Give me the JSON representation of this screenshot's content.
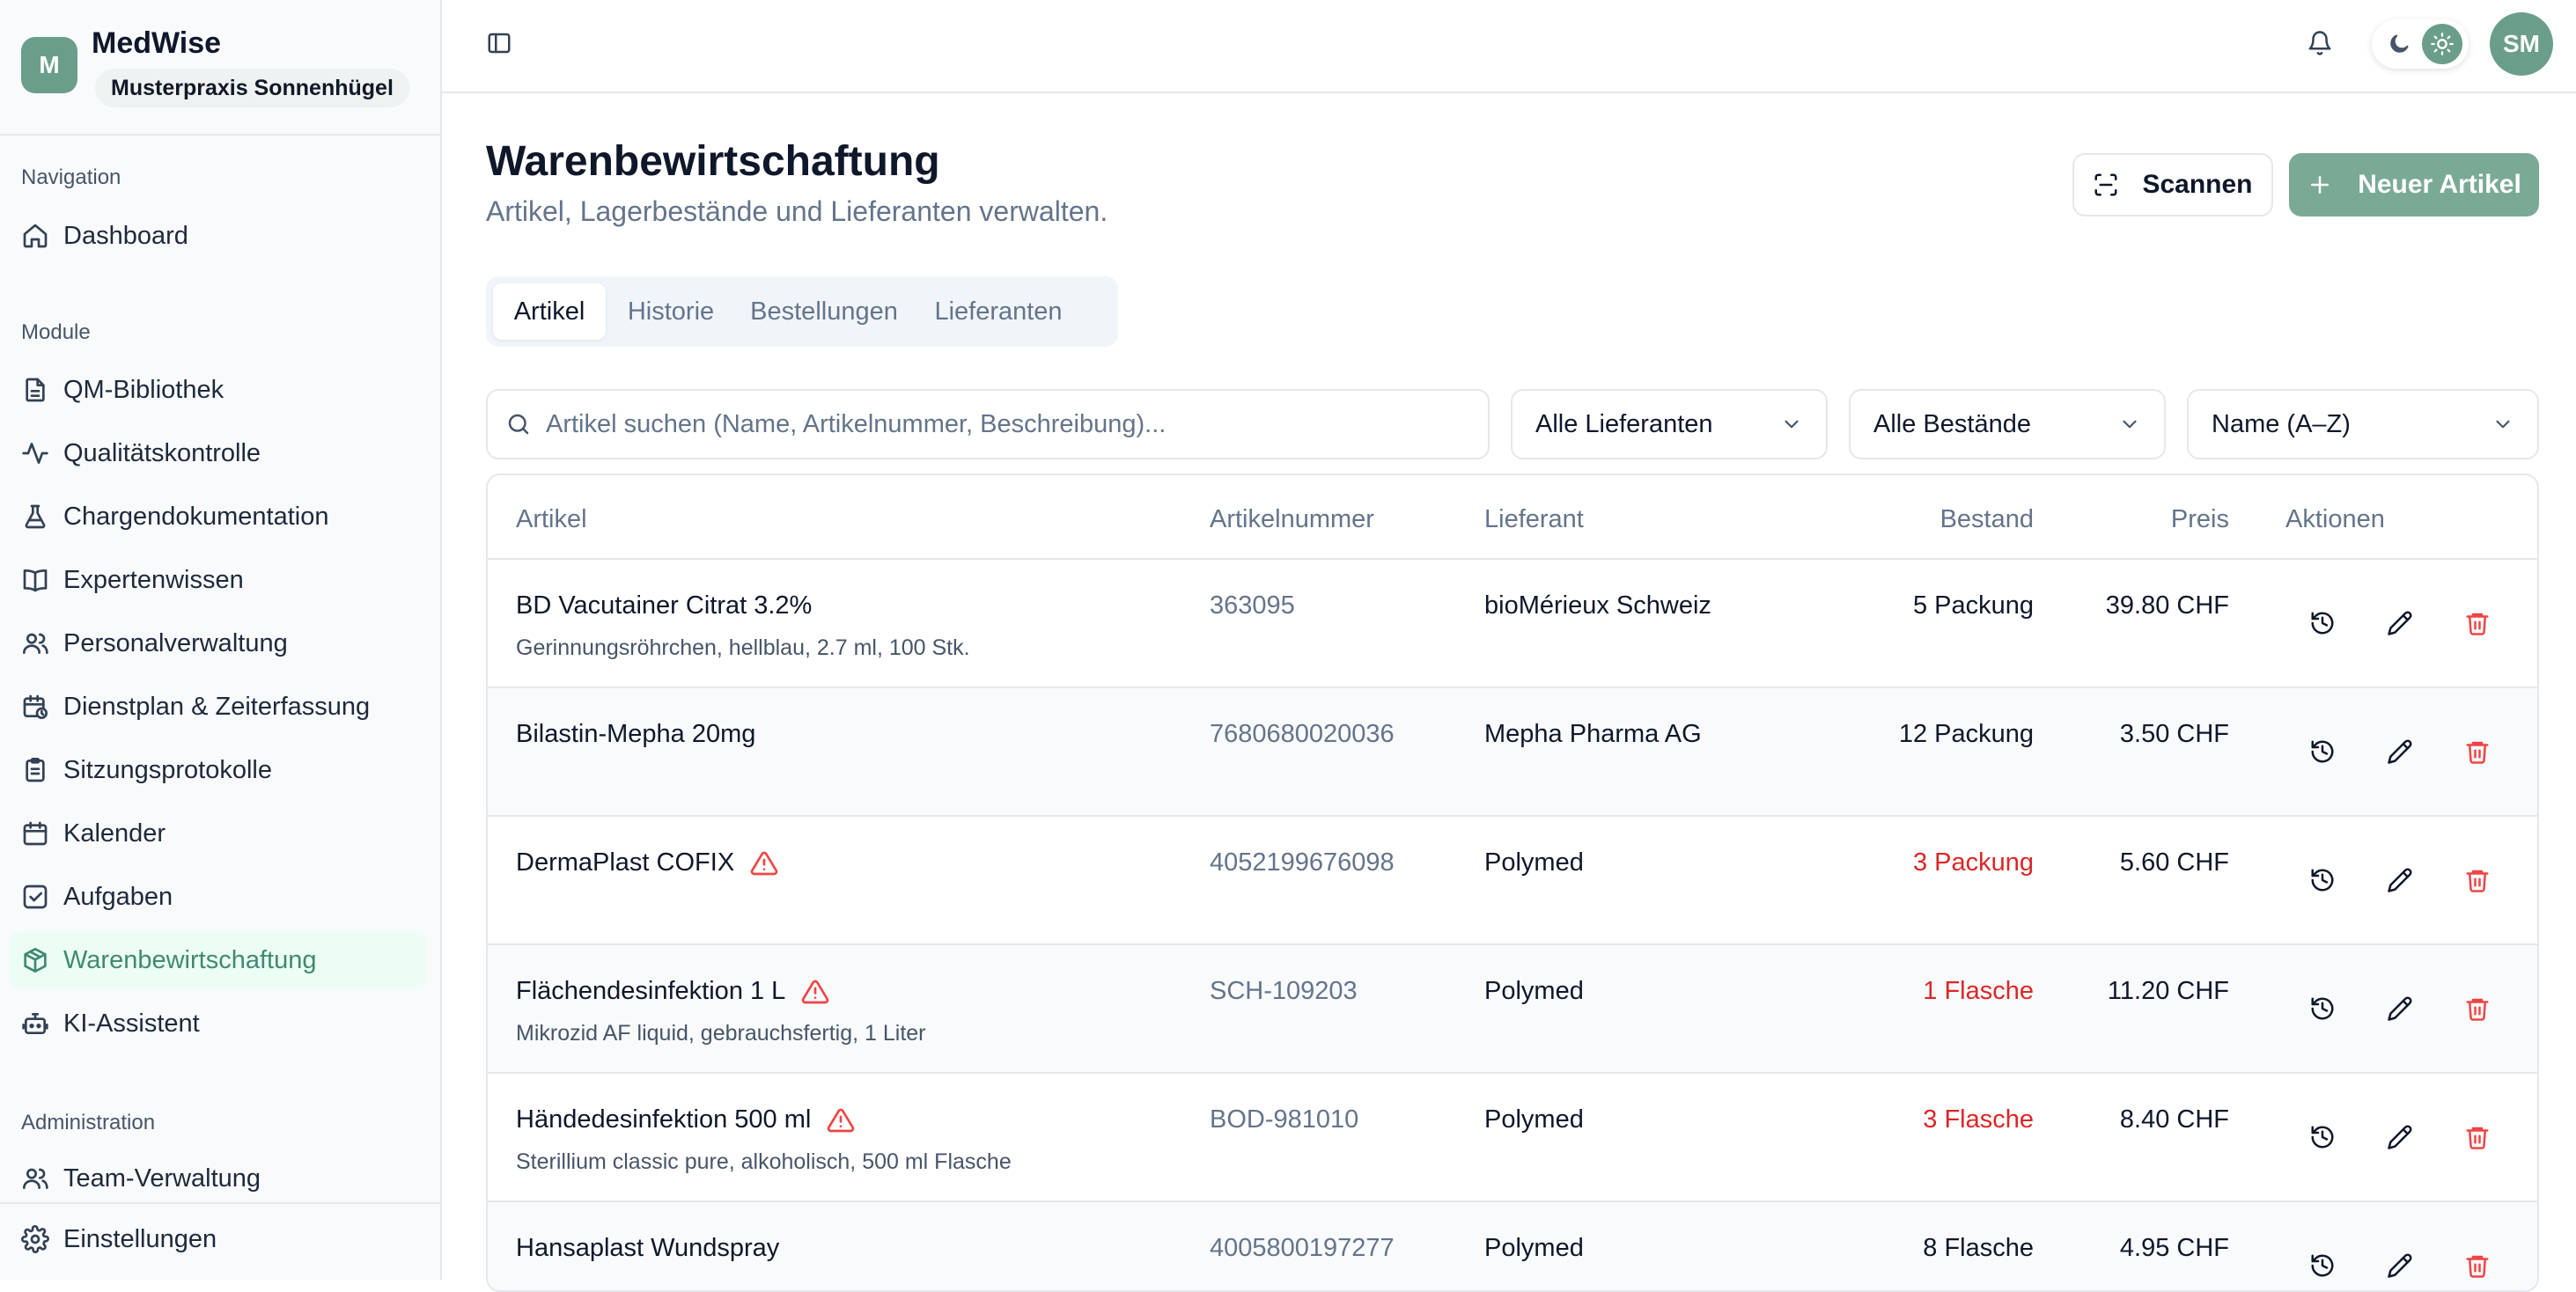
{
  "app": {
    "name": "MedWise",
    "logo_letter": "M",
    "practice": "Musterpraxis Sonnenhügel"
  },
  "sidebar": {
    "sections": {
      "navigation": "Navigation",
      "module": "Module",
      "administration": "Administration"
    },
    "items": [
      {
        "label": "Dashboard",
        "icon": "home-icon"
      },
      {
        "label": "QM-Bibliothek",
        "icon": "document-icon"
      },
      {
        "label": "Qualitätskontrolle",
        "icon": "activity-icon"
      },
      {
        "label": "Chargendokumentation",
        "icon": "flask-icon"
      },
      {
        "label": "Expertenwissen",
        "icon": "book-icon"
      },
      {
        "label": "Personalverwaltung",
        "icon": "users-icon"
      },
      {
        "label": "Dienstplan & Zeiterfassung",
        "icon": "calendar-clock-icon"
      },
      {
        "label": "Sitzungsprotokolle",
        "icon": "clipboard-icon"
      },
      {
        "label": "Kalender",
        "icon": "calendar-icon"
      },
      {
        "label": "Aufgaben",
        "icon": "checkbox-icon"
      },
      {
        "label": "Warenbewirtschaftung",
        "icon": "package-icon",
        "active": true
      },
      {
        "label": "KI-Assistent",
        "icon": "bot-icon"
      },
      {
        "label": "Team-Verwaltung",
        "icon": "users-icon"
      }
    ],
    "settings": "Einstellungen"
  },
  "topbar": {
    "avatar_initials": "SM"
  },
  "header": {
    "title": "Warenbewirtschaftung",
    "subtitle": "Artikel, Lagerbestände und Lieferanten verwalten.",
    "scan_label": "Scannen",
    "new_label": "Neuer Artikel"
  },
  "tabs": [
    "Artikel",
    "Historie",
    "Bestellungen",
    "Lieferanten"
  ],
  "filters": {
    "search_placeholder": "Artikel suchen (Name, Artikelnummer, Beschreibung)...",
    "supplier": "Alle Lieferanten",
    "stock": "Alle Bestände",
    "sort": "Name (A–Z)"
  },
  "table": {
    "columns": [
      "Artikel",
      "Artikelnummer",
      "Lieferant",
      "Bestand",
      "Preis",
      "Aktionen"
    ],
    "rows": [
      {
        "name": "BD Vacutainer Citrat 3.2%",
        "desc": "Gerinnungsröhrchen, hellblau, 2.7 ml, 100 Stk.",
        "number": "363095",
        "supplier": "bioMérieux Schweiz",
        "stock": "5 Packung",
        "low": false,
        "price": "39.80 CHF"
      },
      {
        "name": "Bilastin-Mepha 20mg",
        "desc": "",
        "number": "7680680020036",
        "supplier": "Mepha Pharma AG",
        "stock": "12 Packung",
        "low": false,
        "price": "3.50 CHF"
      },
      {
        "name": "DermaPlast COFIX",
        "desc": "",
        "number": "4052199676098",
        "supplier": "Polymed",
        "stock": "3 Packung",
        "low": true,
        "price": "5.60 CHF"
      },
      {
        "name": "Flächendesinfektion 1 L",
        "desc": "Mikrozid AF liquid, gebrauchsfertig, 1 Liter",
        "number": "SCH-109203",
        "supplier": "Polymed",
        "stock": "1 Flasche",
        "low": true,
        "price": "11.20 CHF"
      },
      {
        "name": "Händedesinfektion 500 ml",
        "desc": "Sterillium classic pure, alkoholisch, 500 ml Flasche",
        "number": "BOD-981010",
        "supplier": "Polymed",
        "stock": "3 Flasche",
        "low": true,
        "price": "8.40 CHF"
      },
      {
        "name": "Hansaplast Wundspray",
        "desc": "",
        "number": "4005800197277",
        "supplier": "Polymed",
        "stock": "8 Flasche",
        "low": false,
        "price": "4.95 CHF"
      }
    ]
  }
}
